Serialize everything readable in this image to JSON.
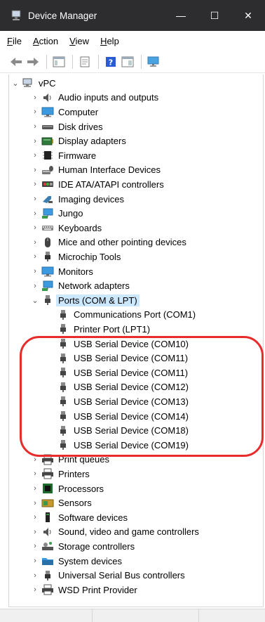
{
  "window": {
    "title": "Device Manager"
  },
  "menu": [
    {
      "accel": "F",
      "rest": "ile"
    },
    {
      "accel": "A",
      "rest": "ction"
    },
    {
      "accel": "V",
      "rest": "iew"
    },
    {
      "accel": "H",
      "rest": "elp"
    }
  ],
  "tree": {
    "root": "vPC",
    "categories_before": [
      {
        "label": "Audio inputs and outputs",
        "icon": "speaker-icon"
      },
      {
        "label": "Computer",
        "icon": "monitor-icon"
      },
      {
        "label": "Disk drives",
        "icon": "disk-icon"
      },
      {
        "label": "Display adapters",
        "icon": "display-icon"
      },
      {
        "label": "Firmware",
        "icon": "chip-icon"
      },
      {
        "label": "Human Interface Devices",
        "icon": "hid-icon"
      },
      {
        "label": "IDE ATA/ATAPI controllers",
        "icon": "ide-icon"
      },
      {
        "label": "Imaging devices",
        "icon": "camera-icon"
      },
      {
        "label": "Jungo",
        "icon": "network-icon"
      },
      {
        "label": "Keyboards",
        "icon": "keyboard-icon"
      },
      {
        "label": "Mice and other pointing devices",
        "icon": "mouse-icon"
      },
      {
        "label": "Microchip Tools",
        "icon": "plug-icon"
      },
      {
        "label": "Monitors",
        "icon": "monitor-icon"
      },
      {
        "label": "Network adapters",
        "icon": "network-icon"
      }
    ],
    "ports": {
      "label": "Ports (COM & LPT)",
      "children": [
        "Communications Port (COM1)",
        "Printer Port (LPT1)",
        "USB Serial Device (COM10)",
        "USB Serial Device (COM11)",
        "USB Serial Device (COM11)",
        "USB Serial Device (COM12)",
        "USB Serial Device (COM13)",
        "USB Serial Device (COM14)",
        "USB Serial Device (COM18)",
        "USB Serial Device (COM19)"
      ]
    },
    "categories_after": [
      {
        "label": "Print queues",
        "icon": "printer-icon"
      },
      {
        "label": "Printers",
        "icon": "printer-icon"
      },
      {
        "label": "Processors",
        "icon": "cpu-icon"
      },
      {
        "label": "Sensors",
        "icon": "sensor-icon"
      },
      {
        "label": "Software devices",
        "icon": "software-icon"
      },
      {
        "label": "Sound, video and game controllers",
        "icon": "speaker-icon"
      },
      {
        "label": "Storage controllers",
        "icon": "storage-icon"
      },
      {
        "label": "System devices",
        "icon": "folder-icon"
      },
      {
        "label": "Universal Serial Bus controllers",
        "icon": "usb-icon"
      },
      {
        "label": "WSD Print Provider",
        "icon": "printer-icon"
      }
    ]
  },
  "colors": {
    "titlebar": "#2d2d30",
    "selection": "#cce8ff",
    "annotation": "#e82b2b"
  }
}
